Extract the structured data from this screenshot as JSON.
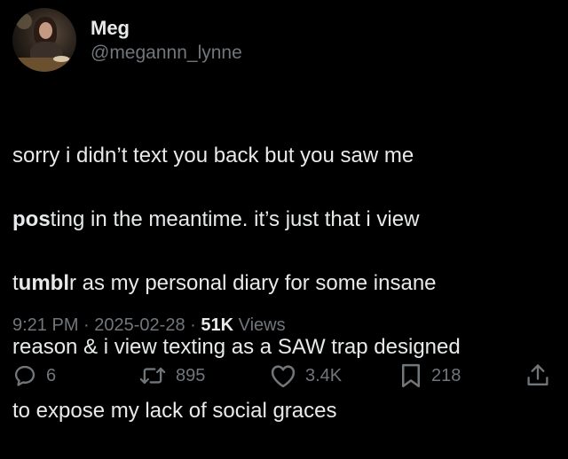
{
  "author": {
    "display_name": "Meg",
    "handle": "@megannn_lynne"
  },
  "tweet": {
    "lines": [
      [
        "sorry i didn’t text you back but you saw me"
      ],
      [
        " ",
        "pos",
        "ting in the meantime. it’s just that i view"
      ],
      [
        "t",
        "umbl",
        "r as my personal diary for some insane"
      ],
      [
        "reason & i view texting as a SAW trap designed"
      ],
      [
        "to expose my lack of social graces"
      ]
    ]
  },
  "meta": {
    "time": "9:21 PM",
    "separator": " · ",
    "date": "2025-02-28",
    "views_count": "51K",
    "views_label": " Views"
  },
  "actions": {
    "replies": "6",
    "retweets": "895",
    "likes": "3.4K",
    "bookmarks": "218"
  },
  "icons": {
    "reply": "reply-icon",
    "retweet": "retweet-icon",
    "like": "heart-icon",
    "bookmark": "bookmark-icon",
    "share": "share-icon"
  },
  "colors": {
    "background": "#000000",
    "text": "#e7e9ea",
    "secondary": "#71767b"
  }
}
